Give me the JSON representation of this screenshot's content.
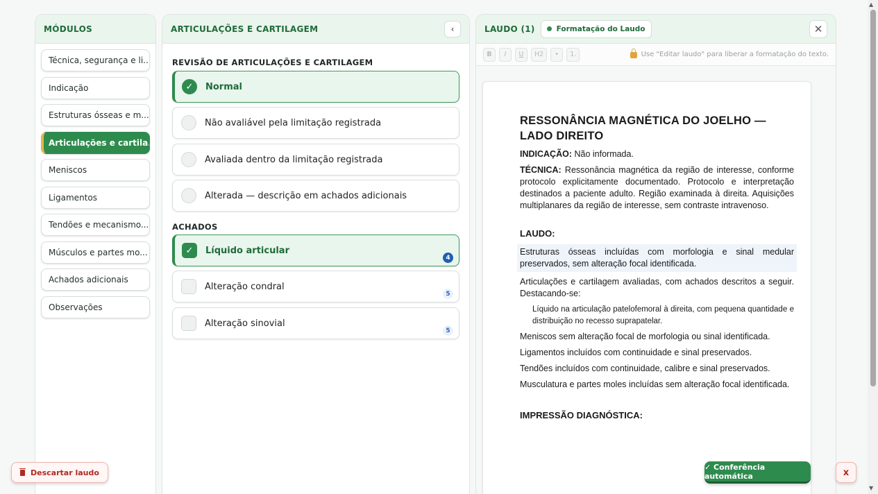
{
  "modules": {
    "title": "MÓDULOS",
    "items": [
      {
        "label": "Técnica, segurança e li...",
        "active": false
      },
      {
        "label": "Indicação",
        "active": false
      },
      {
        "label": "Estruturas ósseas e m...",
        "active": false
      },
      {
        "label": "Articulações e cartila...",
        "active": true
      },
      {
        "label": "Meniscos",
        "active": false
      },
      {
        "label": "Ligamentos",
        "active": false
      },
      {
        "label": "Tendões e mecanismo...",
        "active": false
      },
      {
        "label": "Músculos e partes mo...",
        "active": false
      },
      {
        "label": "Achados adicionais",
        "active": false
      },
      {
        "label": "Observações",
        "active": false
      }
    ]
  },
  "middle": {
    "title": "ARTICULAÇÕES E CARTILAGEM",
    "collapse_glyph": "‹",
    "review_label": "REVISÃO DE ARTICULAÇÕES E CARTILAGEM",
    "review_options": [
      {
        "label": "Normal",
        "selected": true
      },
      {
        "label": "Não avaliável pela limitação registrada",
        "selected": false
      },
      {
        "label": "Avaliada dentro da limitação registrada",
        "selected": false
      },
      {
        "label": "Alterada — descrição em achados adicionais",
        "selected": false
      }
    ],
    "findings_label": "ACHADOS",
    "findings": [
      {
        "label": "Líquido articular",
        "checked": true,
        "count": "4"
      },
      {
        "label": "Alteração condral",
        "checked": false,
        "count": "5"
      },
      {
        "label": "Alteração sinovial",
        "checked": false,
        "count": "5"
      }
    ]
  },
  "report": {
    "title": "LAUDO (1)",
    "format_pill": "Formatação do Laudo",
    "close_glyph": "✕",
    "toolbar": [
      "B",
      "I",
      "U",
      "H2",
      "•",
      "1."
    ],
    "toolbar_hint": "Use \"Editar laudo\" para liberar a formatação do texto.",
    "doc": {
      "title": "RESSONÂNCIA MAGNÉTICA DO JOELHO — LADO DIREITO",
      "indicacao_label": "INDICAÇÃO:",
      "indicacao_text": " Não informada.",
      "tecnica_label": "TÉCNICA:",
      "tecnica_text": " Ressonância magnética da região de interesse, conforme protocolo explicitamente documentado. Protocolo e interpretação destinados a paciente adulto. Região examinada à direita. Aquisições multiplanares da região de interesse, sem contraste intravenoso.",
      "laudo_heading": "LAUDO:",
      "p_osseas": "Estruturas ósseas incluídas com morfologia e sinal medular preservados, sem alteração focal identificada.",
      "p_articulacoes": "Articulações e cartilagem avaliadas, com achados descritos a seguir. Destacando-se:",
      "p_liquido": "Líquido na articulação patelofemoral à direita, com pequena quantidade e distribuição no recesso suprapatelar.",
      "p_meniscos": "Meniscos sem alteração focal de morfologia ou sinal identificada.",
      "p_ligamentos": "Ligamentos incluídos com continuidade e sinal preservados.",
      "p_tendoes": "Tendões incluídos com continuidade, calibre e sinal preservados.",
      "p_musculatura": "Musculatura e partes moles incluídas sem alteração focal identificada.",
      "impressao_heading": "IMPRESSÃO DIAGNÓSTICA:"
    }
  },
  "actions": {
    "discard": "Descartar laudo",
    "auto_check": "✓ Conferência automática",
    "dismiss": "x"
  },
  "colors": {
    "primary_green": "#2e8b4e",
    "header_green_bg": "#eaf5ed",
    "danger_red": "#b02a22",
    "badge_blue": "#1f5fb0"
  }
}
